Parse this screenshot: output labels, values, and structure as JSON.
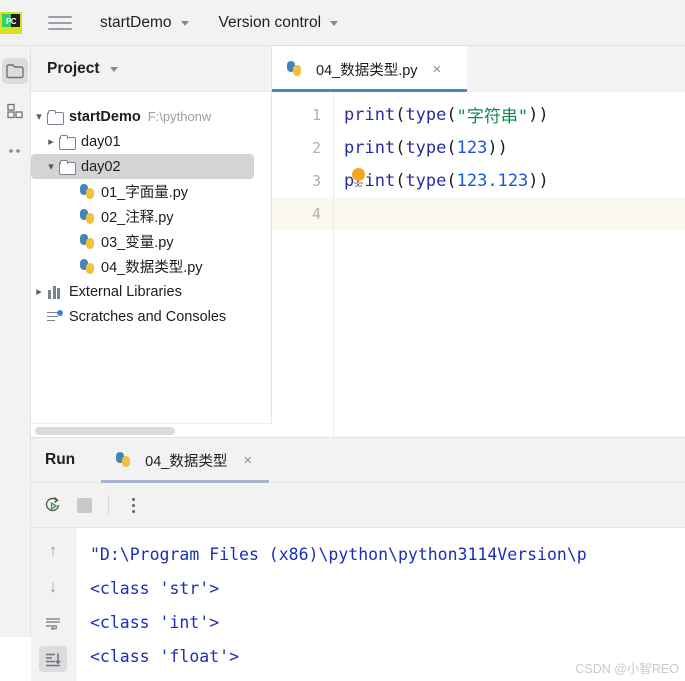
{
  "titlebar": {
    "logo_alt": "pycharm-logo",
    "logo_text": "PC",
    "menu_icon": "hamburger-icon",
    "project_name": "startDemo",
    "version_control": "Version control"
  },
  "left_strip": {
    "items": [
      {
        "icon": "project-folder-icon",
        "active": true
      },
      {
        "icon": "structure-blocks-icon",
        "active": false
      },
      {
        "icon": "more-dots-icon",
        "active": false
      }
    ]
  },
  "project_panel": {
    "title": "Project",
    "tree": [
      {
        "name": "startDemo",
        "path": "F:\\pythonw",
        "icon": "folder-icon",
        "expanded": true,
        "bold": true,
        "indent": 0
      },
      {
        "name": "day01",
        "path": "",
        "icon": "folder-icon",
        "expanded": false,
        "bold": false,
        "indent": 1
      },
      {
        "name": "day02",
        "path": "",
        "icon": "folder-icon",
        "expanded": true,
        "bold": false,
        "indent": 1,
        "selected": true
      },
      {
        "name": "01_字面量.py",
        "path": "",
        "icon": "python-file-icon",
        "indent": 2
      },
      {
        "name": "02_注释.py",
        "path": "",
        "icon": "python-file-icon",
        "indent": 2
      },
      {
        "name": "03_变量.py",
        "path": "",
        "icon": "python-file-icon",
        "indent": 2
      },
      {
        "name": "04_数据类型.py",
        "path": "",
        "icon": "python-file-icon",
        "indent": 2
      },
      {
        "name": "External Libraries",
        "path": "",
        "icon": "library-icon",
        "expanded": false,
        "indent": 0
      },
      {
        "name": "Scratches and Consoles",
        "path": "",
        "icon": "scratches-icon",
        "indent": 0
      }
    ]
  },
  "editor": {
    "tab": {
      "label": "04_数据类型.py",
      "icon": "python-file-icon",
      "close": "×"
    },
    "lines": [
      {
        "num": "1",
        "tokens": [
          {
            "t": "print",
            "c": "fn"
          },
          {
            "t": "(",
            "c": "pn"
          },
          {
            "t": "type",
            "c": "fn"
          },
          {
            "t": "(",
            "c": "pn"
          },
          {
            "t": "\"字符串\"",
            "c": "str"
          },
          {
            "t": "))",
            "c": "pn"
          }
        ]
      },
      {
        "num": "2",
        "tokens": [
          {
            "t": "print",
            "c": "fn"
          },
          {
            "t": "(",
            "c": "pn"
          },
          {
            "t": "type",
            "c": "fn"
          },
          {
            "t": "(",
            "c": "pn"
          },
          {
            "t": "123",
            "c": "num"
          },
          {
            "t": "))",
            "c": "pn"
          }
        ]
      },
      {
        "num": "3",
        "tokens": [
          {
            "t": "print",
            "c": "fn"
          },
          {
            "t": "(",
            "c": "pn"
          },
          {
            "t": "type",
            "c": "fn"
          },
          {
            "t": "(",
            "c": "pn"
          },
          {
            "t": "123.123",
            "c": "num"
          },
          {
            "t": "))",
            "c": "pn"
          }
        ]
      },
      {
        "num": "4",
        "tokens": [],
        "current": true
      }
    ],
    "intention_bulb": "lightbulb-icon"
  },
  "run_panel": {
    "label": "Run",
    "tab": {
      "label": "04_数据类型",
      "icon": "python-file-icon",
      "close": "×"
    },
    "toolbar": [
      {
        "icon": "rerun-icon"
      },
      {
        "icon": "stop-icon"
      },
      {
        "icon": "more-options-icon"
      }
    ],
    "side_buttons": [
      {
        "icon": "up-arrow-icon",
        "glyph": "↑",
        "active": false
      },
      {
        "icon": "down-arrow-icon",
        "glyph": "↓",
        "active": false
      },
      {
        "icon": "soft-wrap-icon",
        "glyph": "↩",
        "active": false
      },
      {
        "icon": "scroll-to-end-icon",
        "glyph": "↓",
        "active": true
      }
    ],
    "console_output": [
      "\"D:\\Program Files (x86)\\python\\python3114Version\\p",
      "<class 'str'>",
      "<class 'int'>",
      "<class 'float'>"
    ]
  },
  "watermark": "CSDN @小智REO",
  "colors": {
    "accent_blue": "#4a86c8",
    "chrome_gray": "#f2f2f2",
    "string_green": "#0b8a4b",
    "number_blue": "#1a55d8",
    "keyword_blue": "#2a2aa5",
    "console_text": "#1a2fb8",
    "selection_gray": "#d4d4d4",
    "bulb_orange": "#f5a623"
  }
}
